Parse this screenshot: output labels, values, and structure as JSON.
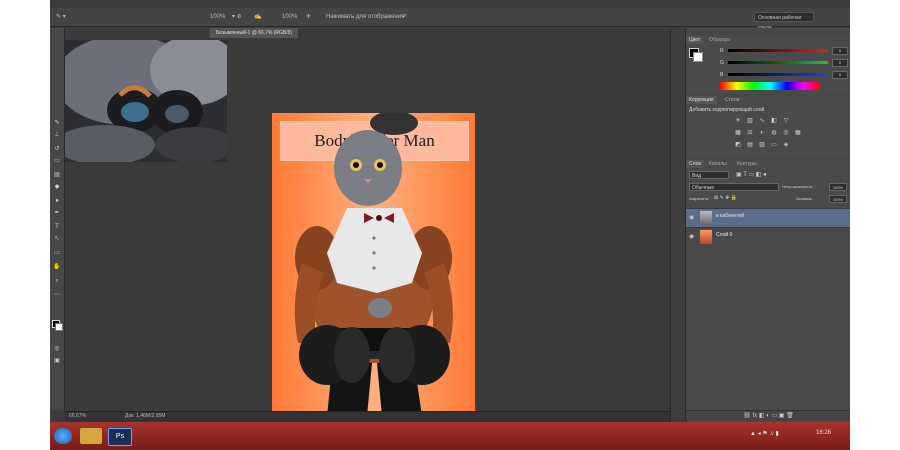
{
  "options_bar": {
    "zoom_pct_1": "100%",
    "zoom_pct_2": "100%",
    "smoothing": "Нажимать для отображения",
    "workspace": "Основная рабочая среда"
  },
  "document": {
    "tab_title": "Безымянный-1 @ 66,7% (RGB/8)"
  },
  "canvas_art": {
    "title_text": "Bodybuilder Man"
  },
  "status_bar": {
    "zoom": "66,67%",
    "doc_size": "Док: 1,46M/2,95M"
  },
  "color_panel": {
    "tabs": [
      "Цвет",
      "Образцы"
    ],
    "channels": [
      "R",
      "G",
      "B"
    ],
    "values": [
      "0",
      "0",
      "0"
    ]
  },
  "adjustments_panel": {
    "tabs": [
      "Коррекция",
      "Стили"
    ],
    "hint": "Добавить корректирующий слой"
  },
  "layers_panel": {
    "tabs": [
      "Слои",
      "Каналы",
      "Контуры"
    ],
    "filter": "Вид",
    "blend_mode": "Обычные",
    "opacity_label": "Непрозрачность:",
    "opacity_value": "100%",
    "lock_label": "Закрепить:",
    "fill_label": "Заливка:",
    "fill_value": "100%",
    "layers": [
      {
        "name": "в кабинетей",
        "selected": true
      },
      {
        "name": "Слой 0",
        "selected": false
      }
    ]
  },
  "taskbar": {
    "clock": "16:26",
    "ps_label": "Ps"
  },
  "colors": {
    "panel_bg": "#474747",
    "canvas_gradient_edge": "#ff7a35",
    "selected_layer": "#5a6e8c",
    "taskbar_red": "#a8342c"
  }
}
